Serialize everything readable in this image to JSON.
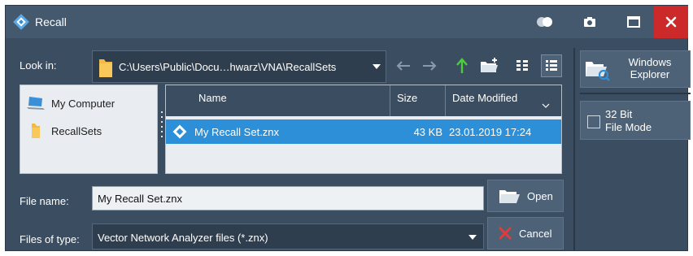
{
  "window": {
    "title": "Recall",
    "buttons": {
      "screenshot": "camera-icon",
      "maximize": "maximize-icon",
      "close": "close-icon"
    }
  },
  "look_in": {
    "label": "Look in:",
    "path": "C:\\Users\\Public\\Docu…hwarz\\VNA\\RecallSets"
  },
  "toolbar": {
    "icons": [
      "back-arrow-icon",
      "forward-arrow-icon",
      "up-folder-icon",
      "new-folder-icon",
      "detail-view-icon",
      "list-view-icon"
    ]
  },
  "places": [
    {
      "label": "My Computer",
      "icon": "computer-icon"
    },
    {
      "label": "RecallSets",
      "icon": "folder-icon"
    }
  ],
  "file_list": {
    "columns": {
      "name": "Name",
      "size": "Size",
      "date": "Date Modified"
    },
    "files": [
      {
        "name": "My Recall Set.znx",
        "size": "43 KB",
        "date": "23.01.2019 17:24",
        "selected": true
      }
    ]
  },
  "file_name": {
    "label": "File name:",
    "value": "My Recall Set.znx"
  },
  "file_type": {
    "label": "Files of type:",
    "value": "Vector Network Analyzer files (*.znx)"
  },
  "buttons": {
    "open": "Open",
    "cancel": "Cancel"
  },
  "side": {
    "explorer_line1": "Windows",
    "explorer_line2": "Explorer",
    "bit_line1": "32 Bit",
    "bit_line2": "File Mode",
    "bit_checked": false
  },
  "colors": {
    "window_bg": "#3b4d61",
    "titlebar_bg": "#45596e",
    "selection": "#2d8fd8",
    "close_red": "#cc2a2a",
    "up_arrow_green": "#4ccd3a",
    "cancel_red": "#e23b3b"
  }
}
